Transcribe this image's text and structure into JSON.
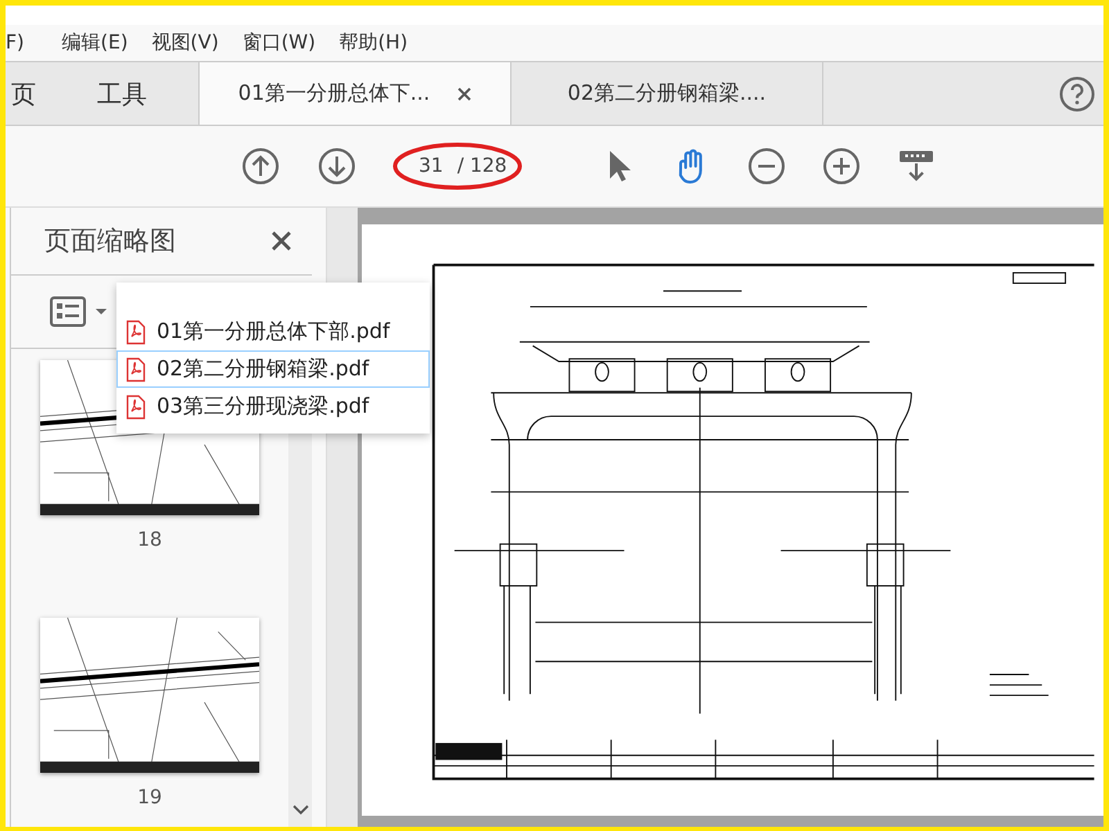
{
  "menu": [
    {
      "label": "F)"
    },
    {
      "label": "编辑(E)"
    },
    {
      "label": "视图(V)"
    },
    {
      "label": "窗口(W)"
    },
    {
      "label": "帮助(H)"
    }
  ],
  "tabs": [
    {
      "kind": "home",
      "label": "页",
      "selected": false
    },
    {
      "kind": "tools",
      "label": "工具",
      "selected": false
    },
    {
      "kind": "document",
      "label": "01第一分册总体下...",
      "selected": true
    },
    {
      "kind": "document",
      "label": "02第二分册钢箱梁....",
      "selected": false
    }
  ],
  "toolbar": {
    "nav_tools": [
      {
        "kind": "up",
        "selected": false
      },
      {
        "kind": "down",
        "selected": false
      }
    ],
    "page_number": "31",
    "page_total": "/ 128",
    "tools": [
      {
        "kind": "pointer",
        "selected": false
      },
      {
        "kind": "hand",
        "selected": true
      },
      {
        "kind": "zoom-out",
        "selected": false
      },
      {
        "kind": "zoom-in",
        "selected": false
      },
      {
        "kind": "keyboard",
        "selected": false
      }
    ]
  },
  "panel": {
    "title": "页面缩略图",
    "thumbnails": [
      {
        "label": "18"
      },
      {
        "label": "19"
      }
    ]
  },
  "popup": {
    "items": [
      {
        "label": "01第一分册总体下部.pdf",
        "selected": false
      },
      {
        "label": "02第二分册钢箱梁.pdf",
        "selected": true
      },
      {
        "label": "03第三分册现浇梁.pdf",
        "selected": false
      }
    ]
  }
}
